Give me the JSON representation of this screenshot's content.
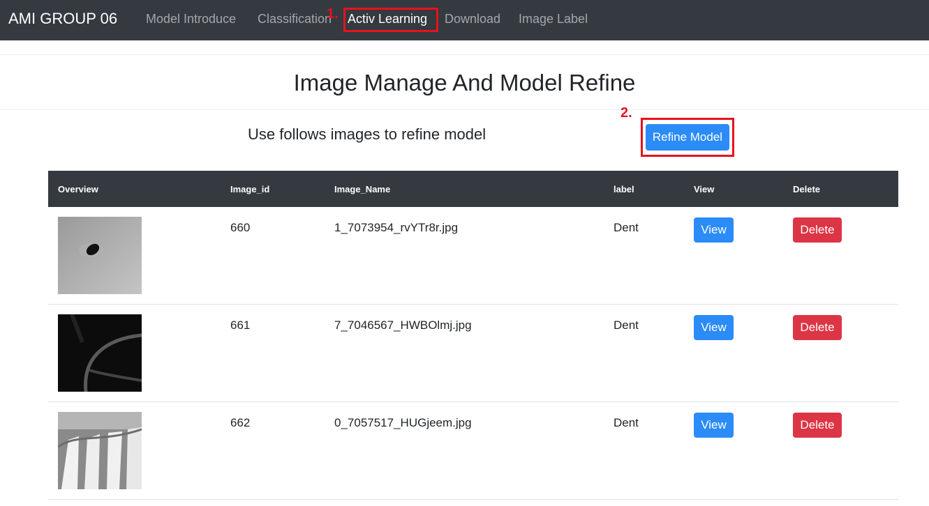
{
  "navbar": {
    "brand": "AMI GROUP 06",
    "items": [
      {
        "label": "Model Introduce"
      },
      {
        "label": "Classification"
      },
      {
        "label": "Activ Learning"
      },
      {
        "label": "Download"
      },
      {
        "label": "Image Label"
      }
    ]
  },
  "annotations": {
    "step1": "1.",
    "step2": "2."
  },
  "page": {
    "title": "Image Manage And Model Refine",
    "subtitle": "Use follows images to refine model",
    "refine_button": "Refine Model"
  },
  "table": {
    "headers": [
      "Overview",
      "Image_id",
      "Image_Name",
      "label",
      "View",
      "Delete"
    ],
    "rows": [
      {
        "id": "660",
        "name": "1_7073954_rvYTr8r.jpg",
        "label": "Dent",
        "view": "View",
        "delete": "Delete"
      },
      {
        "id": "661",
        "name": "7_7046567_HWBOlmj.jpg",
        "label": "Dent",
        "view": "View",
        "delete": "Delete"
      },
      {
        "id": "662",
        "name": "0_7057517_HUGjeem.jpg",
        "label": "Dent",
        "view": "View",
        "delete": "Delete"
      }
    ]
  },
  "colors": {
    "navbar": "#343a40",
    "primary": "#2b8bf7",
    "danger": "#dc3545",
    "annotation": "#e8121c"
  }
}
